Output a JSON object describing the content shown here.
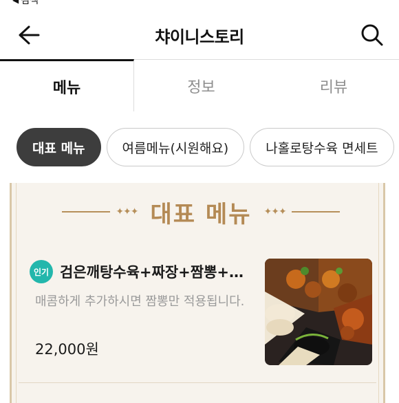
{
  "status_bar": {
    "back_label": "검색"
  },
  "header": {
    "title": "챠이니스토리"
  },
  "tabs": [
    {
      "label": "메뉴",
      "active": true
    },
    {
      "label": "정보",
      "active": false
    },
    {
      "label": "리뷰",
      "active": false
    }
  ],
  "chips": [
    {
      "label": "대표 메뉴",
      "active": true
    },
    {
      "label": "여름메뉴(시원해요)",
      "active": false
    },
    {
      "label": "나홀로탕수육 면세트",
      "active": false
    }
  ],
  "section": {
    "title": "대표 메뉴"
  },
  "menu_item": {
    "badge": "인기",
    "name": "검은깨탕수육+짜장+짬뽕+…",
    "description": "매콤하게 추가하시면 짬뽕만 적용됩니다.",
    "price": "22,000원"
  },
  "colors": {
    "accent_gold": "#b48a55",
    "badge_teal": "#23b7ac",
    "active_chip": "#3d3d3d"
  },
  "icons": {
    "back": "arrow-left-icon",
    "search": "search-icon"
  }
}
